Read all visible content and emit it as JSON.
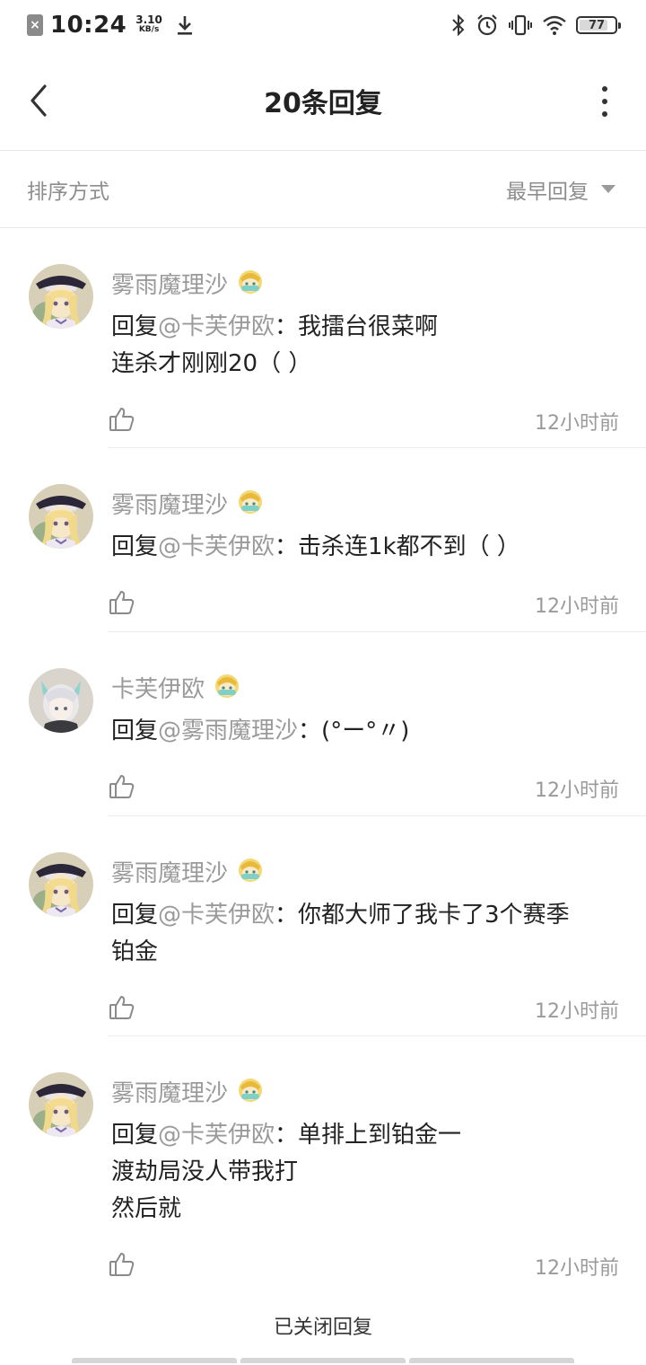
{
  "status_bar": {
    "time": "10:24",
    "net_speed_value": "3.10",
    "net_speed_unit": "KB/s",
    "battery": "77"
  },
  "header": {
    "title": "20条回复"
  },
  "sort": {
    "label": "排序方式",
    "value": "最早回复"
  },
  "replies": [
    {
      "name": "雾雨魔理沙",
      "prefix": "回复",
      "mention": "@卡芙伊欧",
      "colon": "：",
      "lines": [
        "我擂台很菜啊",
        "连杀才刚刚20（ ）"
      ],
      "time": "12小时前",
      "avatar": "marisa"
    },
    {
      "name": "雾雨魔理沙",
      "prefix": "回复",
      "mention": "@卡芙伊欧",
      "colon": "：",
      "lines": [
        "击杀连1k都不到（ ）"
      ],
      "time": "12小时前",
      "avatar": "marisa"
    },
    {
      "name": "卡芙伊欧",
      "prefix": "回复",
      "mention": "@雾雨魔理沙",
      "colon": "：",
      "lines": [
        "(°ー°〃)"
      ],
      "time": "12小时前",
      "avatar": "cafeio"
    },
    {
      "name": "雾雨魔理沙",
      "prefix": "回复",
      "mention": "@卡芙伊欧",
      "colon": "：",
      "lines": [
        "你都大师了我卡了3个赛季",
        "铂金"
      ],
      "time": "12小时前",
      "avatar": "marisa"
    },
    {
      "name": "雾雨魔理沙",
      "prefix": "回复",
      "mention": "@卡芙伊欧",
      "colon": "：",
      "lines": [
        "单排上到铂金一",
        "渡劫局没人带我打",
        "然后就"
      ],
      "time": "12小时前",
      "avatar": "marisa"
    }
  ],
  "footer": {
    "closed_text": "已关闭回复"
  },
  "icons": {
    "back": "back-arrow-icon",
    "more": "more-vertical-icon",
    "like": "thumbs-up-icon",
    "badge": "level-badge-icon"
  }
}
